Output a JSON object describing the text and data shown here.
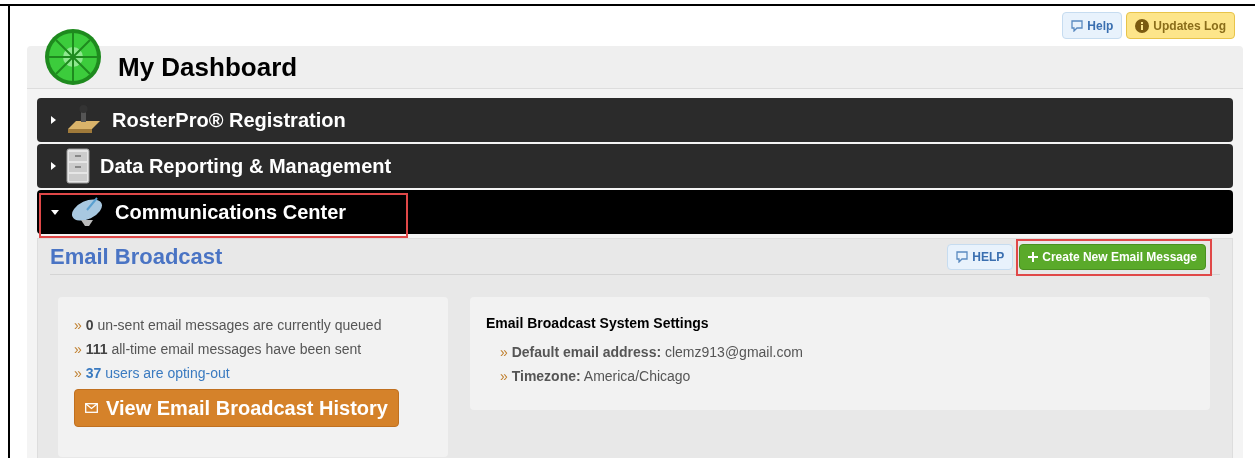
{
  "top_buttons": [
    {
      "kind": "help",
      "label": "Help"
    },
    {
      "kind": "updates",
      "label": "Updates Log"
    }
  ],
  "title": "My Dashboard",
  "sections": [
    {
      "kind": "stamp",
      "label": "RosterPro® Registration",
      "expanded": false,
      "highlighted": false
    },
    {
      "kind": "cabinet",
      "label": "Data Reporting & Management",
      "expanded": false,
      "highlighted": false
    },
    {
      "kind": "dish",
      "label": "Communications Center",
      "expanded": true,
      "highlighted": true
    }
  ],
  "panel": {
    "title": "Email Broadcast",
    "help_label": "HELP",
    "create_button": {
      "label": "Create New Email Message",
      "highlighted": true
    },
    "stats": [
      {
        "bullet": "»",
        "count": "0",
        "text": "un-sent email messages are currently queued",
        "kind": "text"
      },
      {
        "bullet": "»",
        "count": "111",
        "text": "all-time email messages have been sent",
        "kind": "text"
      },
      {
        "bullet": "»",
        "count": "37",
        "text": "users are opting-out",
        "kind": "link"
      }
    ],
    "history_button": "View Email Broadcast History",
    "settings": {
      "title": "Email Broadcast System Settings",
      "items": [
        {
          "bullet": "»",
          "label": "Default email address:",
          "value": "clemz913@gmail.com"
        },
        {
          "bullet": "»",
          "label": "Timezone:",
          "value": "America/Chicago"
        }
      ]
    }
  }
}
